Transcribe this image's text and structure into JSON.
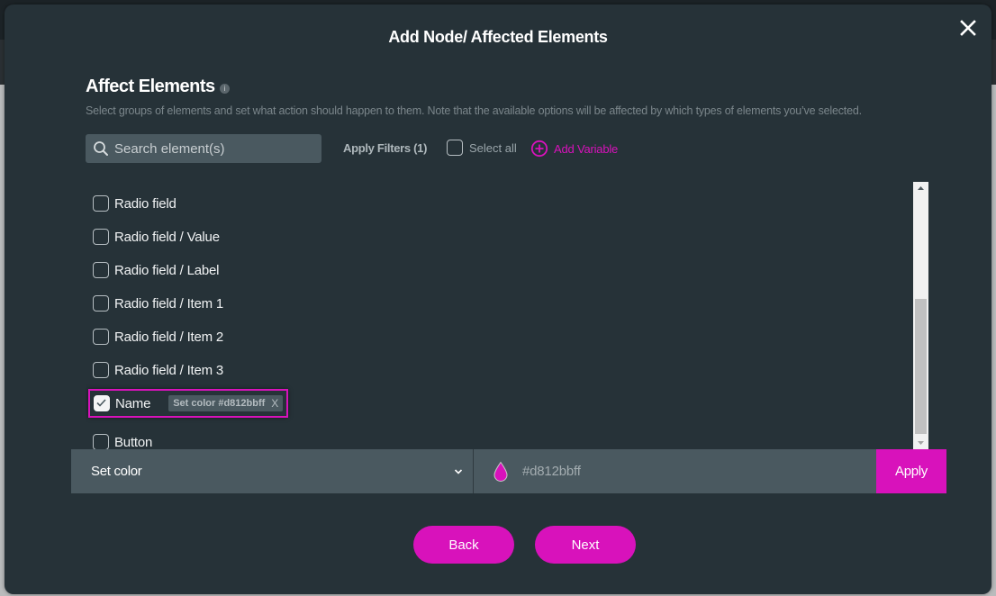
{
  "modal": {
    "title": "Add Node/ Affected Elements",
    "close_icon": "close-icon"
  },
  "section": {
    "title": "Affect Elements",
    "info_icon": "info-icon",
    "info_glyph": "i",
    "description": "Select groups of elements and set what action should happen to them. Note that the available options will be affected by which types of elements you’ve selected."
  },
  "toolbar": {
    "search_placeholder": "Search element(s)",
    "search_value": "",
    "apply_filters_label": "Apply Filters (1)",
    "select_all_label": "Select all",
    "select_all_checked": false,
    "add_variable_label": "Add Variable"
  },
  "elements": [
    {
      "label": "Radio field",
      "checked": false
    },
    {
      "label": "Radio field / Value",
      "checked": false
    },
    {
      "label": "Radio field / Label",
      "checked": false
    },
    {
      "label": "Radio field / Item 1",
      "checked": false
    },
    {
      "label": "Radio field / Item 2",
      "checked": false
    },
    {
      "label": "Radio field / Item 3",
      "checked": false
    },
    {
      "label": "Name",
      "checked": true,
      "tag": "Set color #d812bbff",
      "tag_remove": "X"
    },
    {
      "label": "Button",
      "checked": false
    }
  ],
  "action_bar": {
    "action_selected": "Set color",
    "color_value": "#d812bbff",
    "color_swatch": "#d812bb",
    "apply_label": "Apply"
  },
  "footer": {
    "back_label": "Back",
    "next_label": "Next"
  },
  "colors": {
    "accent": "#d812bb",
    "modal_bg": "#263238",
    "field_bg": "#4a5960"
  }
}
